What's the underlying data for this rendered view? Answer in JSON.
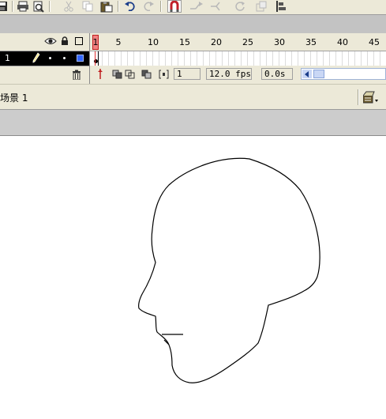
{
  "toolbar": {
    "icons": [
      "save-icon",
      "print-icon",
      "print-preview-icon",
      "cut-icon",
      "copy-icon",
      "paste-icon",
      "undo-icon",
      "redo-icon",
      "snap-magnet-icon",
      "smooth-icon",
      "straighten-icon",
      "rotate-icon",
      "scale-icon",
      "align-icon"
    ]
  },
  "timeline": {
    "frame_ticks": [
      "1",
      "5",
      "10",
      "15",
      "20",
      "25",
      "30",
      "35",
      "40",
      "45"
    ],
    "layer": {
      "name": "1"
    },
    "current_frame": "1",
    "frame_rate": "12.0 fps",
    "elapsed_time": "0.0s"
  },
  "scene": {
    "label": "场景 1"
  },
  "colors": {
    "ui_background": "#ece9d8",
    "layer_row_background": "#000000",
    "playhead": "#e06060",
    "layer_outline_color": "#3366ff"
  }
}
